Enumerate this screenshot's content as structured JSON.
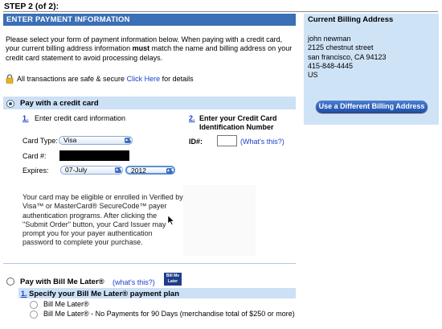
{
  "step": "STEP 2 (of 2):",
  "header": "ENTER PAYMENT INFORMATION",
  "intro": {
    "before": "Please select your form of payment information below. When paying with a credit card, your current billing address information ",
    "bold": "must",
    "after": " match the name and billing address on your credit card statement to avoid processing delays."
  },
  "secure": {
    "text": "All transactions are safe & secure ",
    "link": "Click Here",
    "after": " for details"
  },
  "credit_card": {
    "label": "Pay with a credit card",
    "selected": true,
    "step1_num": "1.",
    "step1_label": "Enter credit card information",
    "card_type_label": "Card Type:",
    "card_type_value": "Visa",
    "card_number_label": "Card #:",
    "expires_label": "Expires:",
    "expires_month": "07-July",
    "expires_year": "2012",
    "step2_num": "2.",
    "step2_label": "Enter your Credit Card Identification Number",
    "id_label": "ID#:",
    "whats_this": "(What's this?)",
    "verified_text": "Your card may be eligible or enrolled in Verified by Visa™ or MasterCard® SecureCode™ payer authentication programs. After clicking the \"Submit Order\" button, your Card Issuer may prompt you for your payer authentication password to complete your purchase."
  },
  "bill_me_later": {
    "label": "Pay with Bill Me Later®",
    "whats_this": "(what's this?)",
    "logo_top": "Bill Me",
    "logo_bottom": "Later",
    "step_num": "1.",
    "step_label": "Specify your Bill Me Later® payment plan",
    "options": [
      "Bill Me Later®",
      "Bill Me Later® - No Payments for 90 Days (merchandise total of $250 or more)"
    ]
  },
  "billing": {
    "title": "Current Billing Address",
    "lines": [
      "john newman",
      "2125 chestnut street",
      "san francisco, CA  94123",
      "415-848-4445",
      "US"
    ],
    "button": "Use a Different Billing Address"
  }
}
